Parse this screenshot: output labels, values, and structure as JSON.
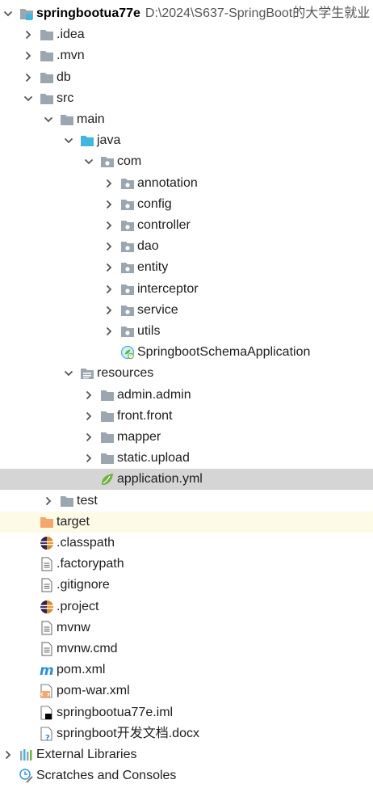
{
  "project": {
    "name": "springbootua77e",
    "path": "D:\\2024\\S637-SpringBoot的大学生就业"
  },
  "tree": [
    {
      "label": "springbootua77e",
      "depth": 0,
      "arrow": "down",
      "icon": "module-folder-icon"
    },
    {
      "label": ".idea",
      "depth": 1,
      "arrow": "right",
      "icon": "folder-icon"
    },
    {
      "label": ".mvn",
      "depth": 1,
      "arrow": "right",
      "icon": "folder-icon"
    },
    {
      "label": "db",
      "depth": 1,
      "arrow": "right",
      "icon": "folder-icon"
    },
    {
      "label": "src",
      "depth": 1,
      "arrow": "down",
      "icon": "folder-icon"
    },
    {
      "label": "main",
      "depth": 2,
      "arrow": "down",
      "icon": "folder-icon"
    },
    {
      "label": "java",
      "depth": 3,
      "arrow": "down",
      "icon": "source-folder-icon"
    },
    {
      "label": "com",
      "depth": 4,
      "arrow": "down",
      "icon": "package-icon"
    },
    {
      "label": "annotation",
      "depth": 5,
      "arrow": "right",
      "icon": "package-icon"
    },
    {
      "label": "config",
      "depth": 5,
      "arrow": "right",
      "icon": "package-icon"
    },
    {
      "label": "controller",
      "depth": 5,
      "arrow": "right",
      "icon": "package-icon"
    },
    {
      "label": "dao",
      "depth": 5,
      "arrow": "right",
      "icon": "package-icon"
    },
    {
      "label": "entity",
      "depth": 5,
      "arrow": "right",
      "icon": "package-icon"
    },
    {
      "label": "interceptor",
      "depth": 5,
      "arrow": "right",
      "icon": "package-icon"
    },
    {
      "label": "service",
      "depth": 5,
      "arrow": "right",
      "icon": "package-icon"
    },
    {
      "label": "utils",
      "depth": 5,
      "arrow": "right",
      "icon": "package-icon"
    },
    {
      "label": "SpringbootSchemaApplication",
      "depth": 5,
      "arrow": "none",
      "icon": "spring-boot-class-icon"
    },
    {
      "label": "resources",
      "depth": 3,
      "arrow": "down",
      "icon": "resources-folder-icon"
    },
    {
      "label": "admin.admin",
      "depth": 4,
      "arrow": "right",
      "icon": "folder-icon"
    },
    {
      "label": "front.front",
      "depth": 4,
      "arrow": "right",
      "icon": "folder-icon"
    },
    {
      "label": "mapper",
      "depth": 4,
      "arrow": "right",
      "icon": "folder-icon"
    },
    {
      "label": "static.upload",
      "depth": 4,
      "arrow": "right",
      "icon": "folder-icon"
    },
    {
      "label": "application.yml",
      "depth": 4,
      "arrow": "none",
      "icon": "spring-yml-icon",
      "selected": true
    },
    {
      "label": "test",
      "depth": 2,
      "arrow": "right",
      "icon": "folder-icon"
    },
    {
      "label": "target",
      "depth": 1,
      "arrow": "none",
      "icon": "excluded-folder-icon",
      "excluded": true
    },
    {
      "label": ".classpath",
      "depth": 1,
      "arrow": "none",
      "icon": "eclipse-icon"
    },
    {
      "label": ".factorypath",
      "depth": 1,
      "arrow": "none",
      "icon": "text-file-icon"
    },
    {
      "label": ".gitignore",
      "depth": 1,
      "arrow": "none",
      "icon": "text-file-icon"
    },
    {
      "label": ".project",
      "depth": 1,
      "arrow": "none",
      "icon": "eclipse-icon"
    },
    {
      "label": "mvnw",
      "depth": 1,
      "arrow": "none",
      "icon": "text-file-icon"
    },
    {
      "label": "mvnw.cmd",
      "depth": 1,
      "arrow": "none",
      "icon": "text-file-icon"
    },
    {
      "label": "pom.xml",
      "depth": 1,
      "arrow": "none",
      "icon": "maven-icon"
    },
    {
      "label": "pom-war.xml",
      "depth": 1,
      "arrow": "none",
      "icon": "xml-file-icon"
    },
    {
      "label": "springbootua77e.iml",
      "depth": 1,
      "arrow": "none",
      "icon": "iml-file-icon"
    },
    {
      "label": "springboot开发文档.docx",
      "depth": 1,
      "arrow": "none",
      "icon": "unknown-file-icon"
    },
    {
      "label": "External Libraries",
      "depth": 0,
      "arrow": "right",
      "icon": "libraries-icon"
    },
    {
      "label": "Scratches and Consoles",
      "depth": 0,
      "arrow": "none",
      "icon": "scratches-icon"
    }
  ],
  "colors": {
    "selection": "#d5d5d5",
    "excluded_row": "#fdfbe6",
    "folder": "#9aa7b0",
    "source_folder": "#40b6e0",
    "excluded_folder": "#f4a66d"
  }
}
